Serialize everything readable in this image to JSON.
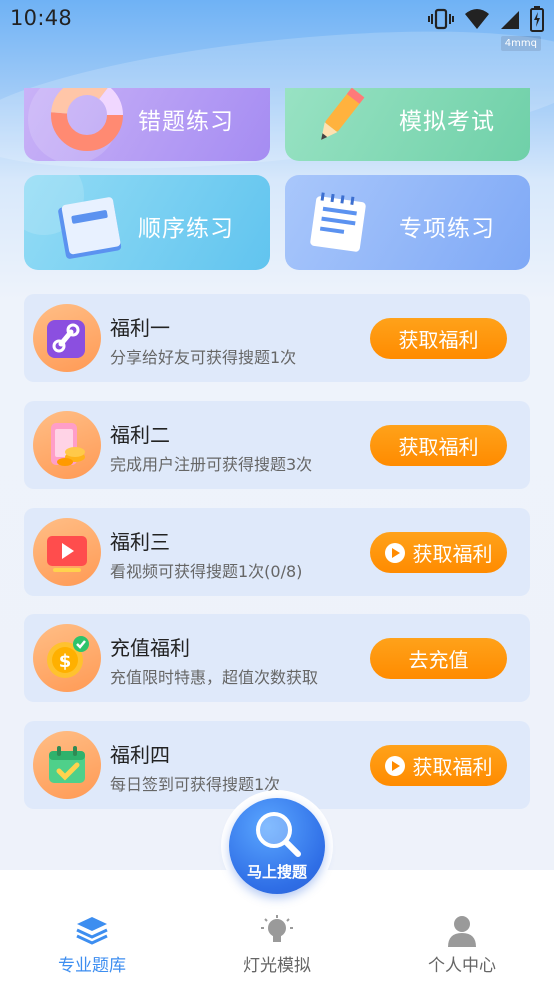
{
  "status_bar": {
    "time": "10:48",
    "tag": "4mmq"
  },
  "tiles": [
    {
      "label": "错题练习"
    },
    {
      "label": "模拟考试"
    },
    {
      "label": "顺序练习"
    },
    {
      "label": "专项练习"
    }
  ],
  "welfare": [
    {
      "title": "福利一",
      "desc": "分享给好友可获得搜题1次",
      "button": "获取福利",
      "icon": "share-link-icon",
      "has_play": false
    },
    {
      "title": "福利二",
      "desc": "完成用户注册可获得搜题3次",
      "button": "获取福利",
      "icon": "phone-coins-icon",
      "has_play": false
    },
    {
      "title": "福利三",
      "desc": "看视频可获得搜题1次(0/8)",
      "button": "获取福利",
      "icon": "video-play-icon",
      "has_play": true
    },
    {
      "title": "充值福利",
      "desc": "充值限时特惠，超值次数获取",
      "button": "去充值",
      "icon": "dollar-coin-icon",
      "has_play": false
    },
    {
      "title": "福利四",
      "desc": "每日签到可获得搜题1次",
      "button": "获取福利",
      "icon": "calendar-check-icon",
      "has_play": true
    }
  ],
  "fab": {
    "label": "马上搜题"
  },
  "tabbar": [
    {
      "label": "专业题库",
      "active": true
    },
    {
      "label": "灯光模拟",
      "active": false
    },
    {
      "label": "个人中心",
      "active": false
    }
  ],
  "colors": {
    "accent": "#3d8ef0",
    "button": "#ff8b00"
  }
}
